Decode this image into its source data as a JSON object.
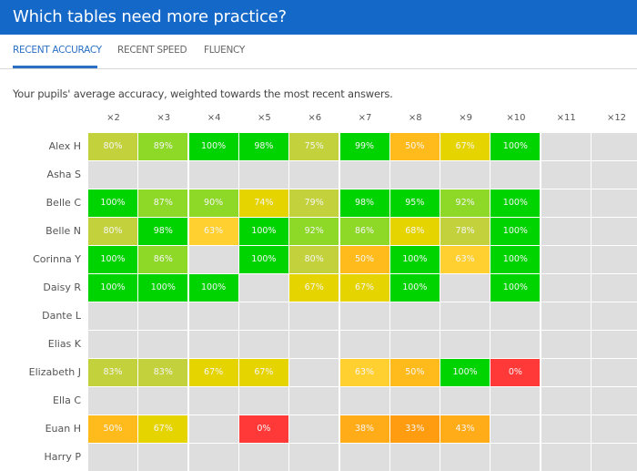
{
  "header": {
    "title": "Which tables need more practice?"
  },
  "tabs": [
    {
      "label": "RECENT ACCURACY",
      "active": true
    },
    {
      "label": "RECENT SPEED",
      "active": false
    },
    {
      "label": "FLUENCY",
      "active": false
    }
  ],
  "description": "Your pupils' average accuracy, weighted towards the most recent answers.",
  "colors": {
    "header_bg": "#1468c8",
    "accent": "#2a6fc4",
    "empty": "#dedede",
    "scale": [
      {
        "min": 95,
        "color": "#00d400"
      },
      {
        "min": 84,
        "color": "#8ed828"
      },
      {
        "min": 75,
        "color": "#c3d23c"
      },
      {
        "min": 64,
        "color": "#e6d400"
      },
      {
        "min": 58,
        "color": "#ffd030"
      },
      {
        "min": 44,
        "color": "#ffbb1c"
      },
      {
        "min": 36,
        "color": "#ffac18"
      },
      {
        "min": 20,
        "color": "#ff9c10"
      },
      {
        "min": 0,
        "color": "#ff3838"
      }
    ]
  },
  "columns": [
    "×2",
    "×3",
    "×4",
    "×5",
    "×6",
    "×7",
    "×8",
    "×9",
    "×10",
    "×11",
    "×12"
  ],
  "rows": [
    {
      "name": "Alex H",
      "values": [
        80,
        89,
        100,
        98,
        75,
        99,
        50,
        67,
        100,
        null,
        null
      ]
    },
    {
      "name": "Asha S",
      "values": [
        null,
        null,
        null,
        null,
        null,
        null,
        null,
        null,
        null,
        null,
        null
      ]
    },
    {
      "name": "Belle C",
      "values": [
        100,
        87,
        90,
        74,
        79,
        98,
        95,
        92,
        100,
        null,
        null
      ]
    },
    {
      "name": "Belle N",
      "values": [
        80,
        98,
        63,
        100,
        92,
        86,
        68,
        78,
        100,
        null,
        null
      ]
    },
    {
      "name": "Corinna Y",
      "values": [
        100,
        86,
        null,
        100,
        80,
        50,
        100,
        63,
        100,
        null,
        null
      ]
    },
    {
      "name": "Daisy R",
      "values": [
        100,
        100,
        100,
        null,
        67,
        67,
        100,
        null,
        100,
        null,
        null
      ]
    },
    {
      "name": "Dante L",
      "values": [
        null,
        null,
        null,
        null,
        null,
        null,
        null,
        null,
        null,
        null,
        null
      ]
    },
    {
      "name": "Elias K",
      "values": [
        null,
        null,
        null,
        null,
        null,
        null,
        null,
        null,
        null,
        null,
        null
      ]
    },
    {
      "name": "Elizabeth J",
      "values": [
        83,
        83,
        67,
        67,
        null,
        63,
        50,
        100,
        0,
        null,
        null
      ]
    },
    {
      "name": "Ella C",
      "values": [
        null,
        null,
        null,
        null,
        null,
        null,
        null,
        null,
        null,
        null,
        null
      ]
    },
    {
      "name": "Euan H",
      "values": [
        50,
        67,
        null,
        0,
        null,
        38,
        33,
        43,
        null,
        null,
        null
      ]
    },
    {
      "name": "Harry P",
      "values": [
        null,
        null,
        null,
        null,
        null,
        null,
        null,
        null,
        null,
        null,
        null
      ]
    }
  ]
}
